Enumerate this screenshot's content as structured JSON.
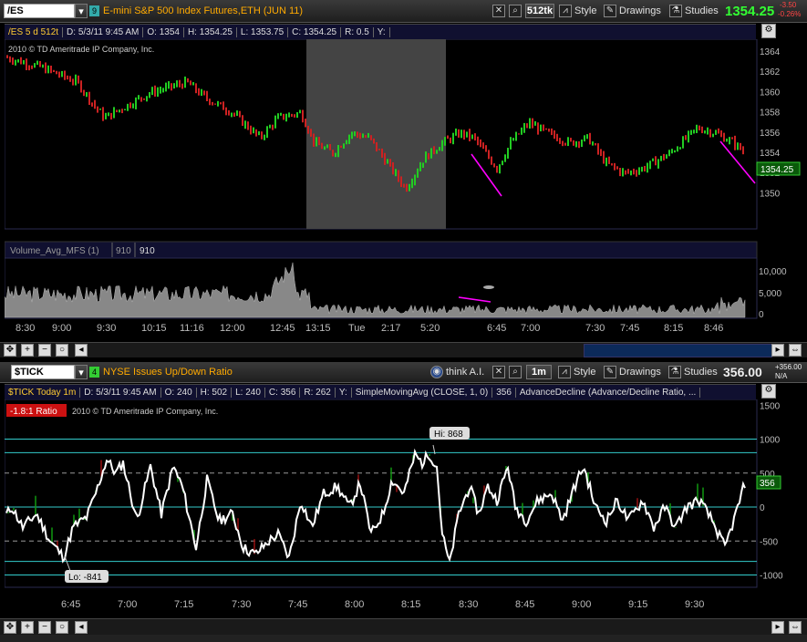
{
  "top": {
    "symbol": "/ES",
    "link_num": "9",
    "description": "E-mini S&P 500 Index Futures,ETH (JUN 11)",
    "aggregation": "512tk",
    "style_label": "Style",
    "drawings_label": "Drawings",
    "studies_label": "Studies",
    "last_price": "1354.25",
    "change": "-3.50",
    "change_pct": "-0.26%",
    "info": [
      "/ES 5 d 512t",
      "D: 5/3/11 9:45 AM",
      "O: 1354",
      "H: 1354.25",
      "L: 1353.75",
      "C: 1354.25",
      "R: 0.5",
      "Y:"
    ],
    "copyright": "2010 © TD Ameritrade IP Company, Inc.",
    "price_axis": [
      "1364",
      "1362",
      "1360",
      "1358",
      "1356",
      "1354",
      "1352",
      "1350"
    ],
    "price_marker": "1354.25",
    "volume_study": [
      "Volume_Avg_MFS (1)",
      "910",
      "910"
    ],
    "volume_axis": [
      "10,000",
      "5,000",
      "0"
    ],
    "time_axis": [
      "8:30",
      "9:00",
      "9:30",
      "10:15",
      "11:16",
      "12:00",
      "12:45",
      "13:15",
      "Tue",
      "2:17",
      "5:20",
      "6:45",
      "7:00",
      "7:30",
      "7:45",
      "8:15",
      "8:46"
    ]
  },
  "bottom": {
    "symbol": "$TICK",
    "link_num": "4",
    "description": "NYSE Issues Up/Down Ratio",
    "think_label": "think A.I.",
    "aggregation": "1m",
    "style_label": "Style",
    "drawings_label": "Drawings",
    "studies_label": "Studies",
    "last_price": "356.00",
    "change": "+356.00",
    "change_pct": "N/A",
    "info": [
      "$TICK Today 1m",
      "D: 5/3/11 9:45 AM",
      "O: 240",
      "H: 502",
      "L: 240",
      "C: 356",
      "R: 262",
      "Y:",
      "SimpleMovingAvg (CLOSE, 1, 0)",
      "356",
      "AdvanceDecline (Advance/Decline Ratio, ..."
    ],
    "ratio_badge": "-1.8:1 Ratio",
    "copyright": "2010 © TD Ameritrade IP Company, Inc.",
    "hi_label": "Hi: 868",
    "lo_label": "Lo: -841",
    "y_axis": [
      "1500",
      "1000",
      "500",
      "0",
      "-500",
      "-1000"
    ],
    "price_marker": "356",
    "time_axis": [
      "6:45",
      "7:00",
      "7:15",
      "7:30",
      "7:45",
      "8:00",
      "8:15",
      "8:30",
      "8:45",
      "9:00",
      "9:15",
      "9:30"
    ]
  },
  "colors": {
    "up_bar": "#22cc22",
    "down_bar": "#cc2222",
    "trend_line": "#ff00ff",
    "tick_line": "#ffffff",
    "level_line": "#33cccc",
    "green_price": "#33ff33"
  }
}
